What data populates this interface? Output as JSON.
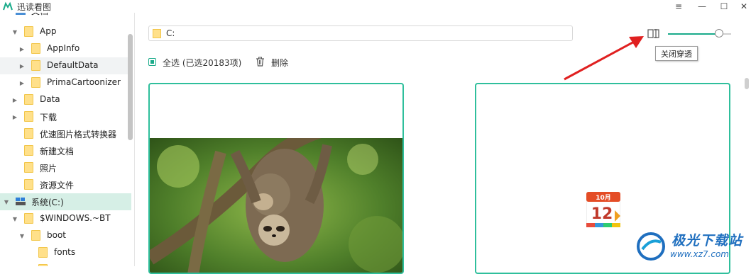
{
  "app": {
    "title": "迅读看图",
    "controls": {
      "menu": "≡",
      "minimize": "—",
      "maximize": "☐",
      "close": "✕"
    }
  },
  "sidebar": {
    "items": [
      {
        "label": "文档",
        "level": 1
      },
      {
        "label": "App",
        "level": 1,
        "expanded": true
      },
      {
        "label": "AppInfo",
        "level": 2,
        "expanded": false
      },
      {
        "label": "DefaultData",
        "level": 2,
        "expanded": false
      },
      {
        "label": "PrimaCartoonizer",
        "level": 2,
        "expanded": false
      },
      {
        "label": "Data",
        "level": 1,
        "expanded": false
      },
      {
        "label": "下载",
        "level": 1,
        "expanded": false
      },
      {
        "label": "优速图片格式转换器",
        "level": 1
      },
      {
        "label": "新建文档",
        "level": 1
      },
      {
        "label": "照片",
        "level": 1
      },
      {
        "label": "资源文件",
        "level": 1
      },
      {
        "label": "系统(C:)",
        "level": 0,
        "expanded": true,
        "selected": true
      },
      {
        "label": "$WINDOWS.~BT",
        "level": 1,
        "expanded": true
      },
      {
        "label": "boot",
        "level": 2,
        "expanded": true
      },
      {
        "label": "fonts",
        "level": 3
      }
    ]
  },
  "toolbar": {
    "path": "C:",
    "tooltip": "关闭穿透",
    "zoom_level": 0.75,
    "select_all_label": "全选 (已选20183项)",
    "delete_label": "删除"
  },
  "grid": {
    "cards": [
      {
        "type": "photo",
        "alt": "sloth"
      },
      {
        "type": "app-icon",
        "cal_month": "10月",
        "cal_day": "12"
      }
    ]
  },
  "watermark": {
    "brand": "极光下载站",
    "site": "www.xz7.com"
  },
  "colors": {
    "accent": "#1aab8a",
    "card_border": "#2fbf9c",
    "folder": "#ffe08a",
    "arrow": "#e02020"
  }
}
